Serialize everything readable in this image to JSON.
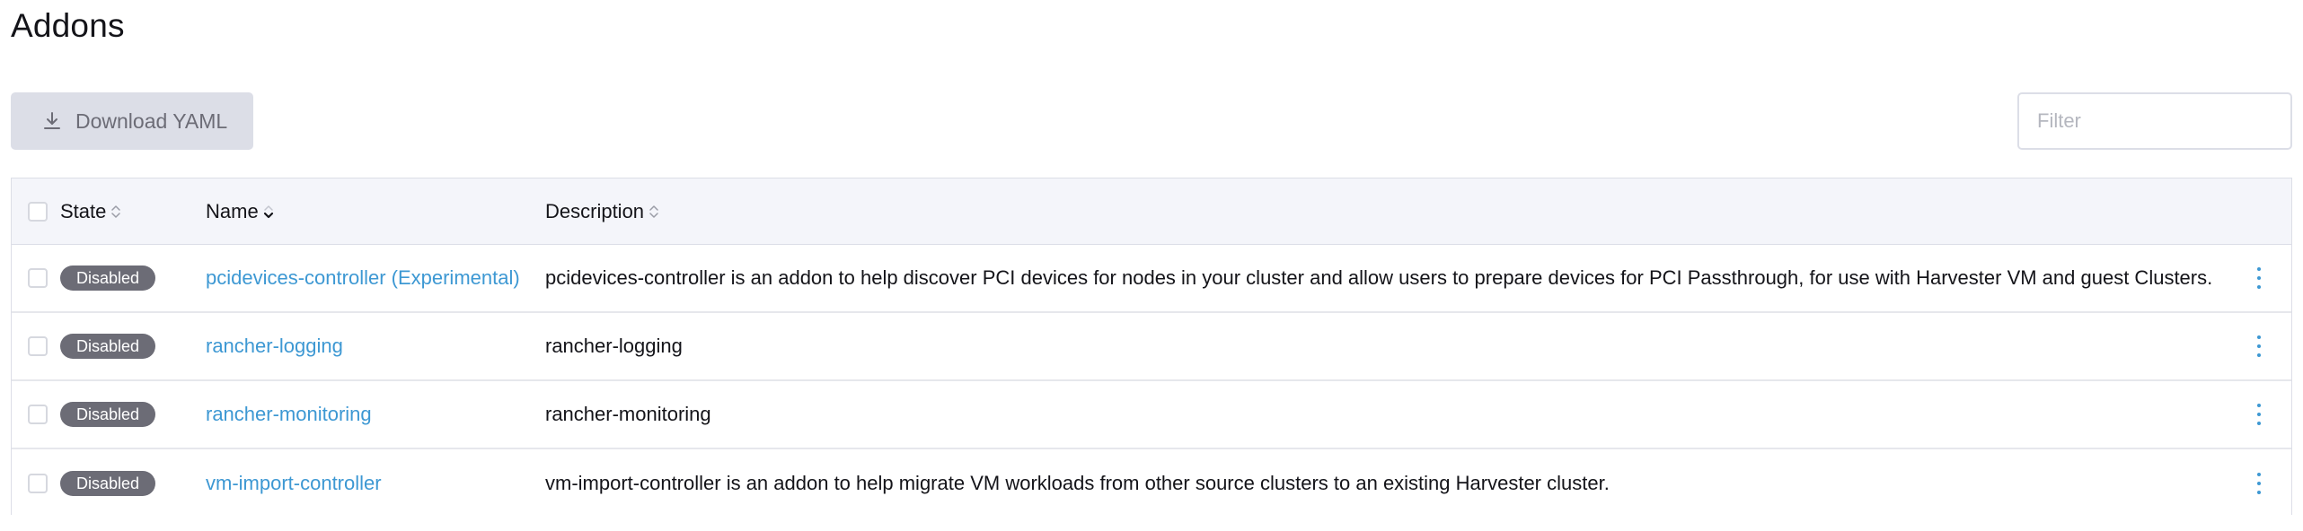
{
  "page": {
    "title": "Addons"
  },
  "toolbar": {
    "download_label": "Download YAML",
    "download_icon": "download-icon",
    "filter_placeholder": "Filter",
    "filter_value": ""
  },
  "table": {
    "columns": [
      {
        "label": "State",
        "sort": "unsorted"
      },
      {
        "label": "Name",
        "sort": "descending"
      },
      {
        "label": "Description",
        "sort": "unsorted"
      }
    ],
    "rows": [
      {
        "state": "Disabled",
        "name": "pcidevices-controller (Experimental)",
        "description": "pcidevices-controller is an addon to help discover PCI devices for nodes in your cluster and allow users to prepare devices for PCI Passthrough, for use with Harvester VM and guest Clusters."
      },
      {
        "state": "Disabled",
        "name": "rancher-logging",
        "description": "rancher-logging"
      },
      {
        "state": "Disabled",
        "name": "rancher-monitoring",
        "description": "rancher-monitoring"
      },
      {
        "state": "Disabled",
        "name": "vm-import-controller",
        "description": "vm-import-controller is an addon to help migrate VM workloads from other source clusters to an existing Harvester cluster."
      }
    ]
  },
  "colors": {
    "link": "#3d98d3",
    "badge": "#6c6c76",
    "button_bg": "#dcdee7",
    "header_bg": "#f4f5fa"
  }
}
